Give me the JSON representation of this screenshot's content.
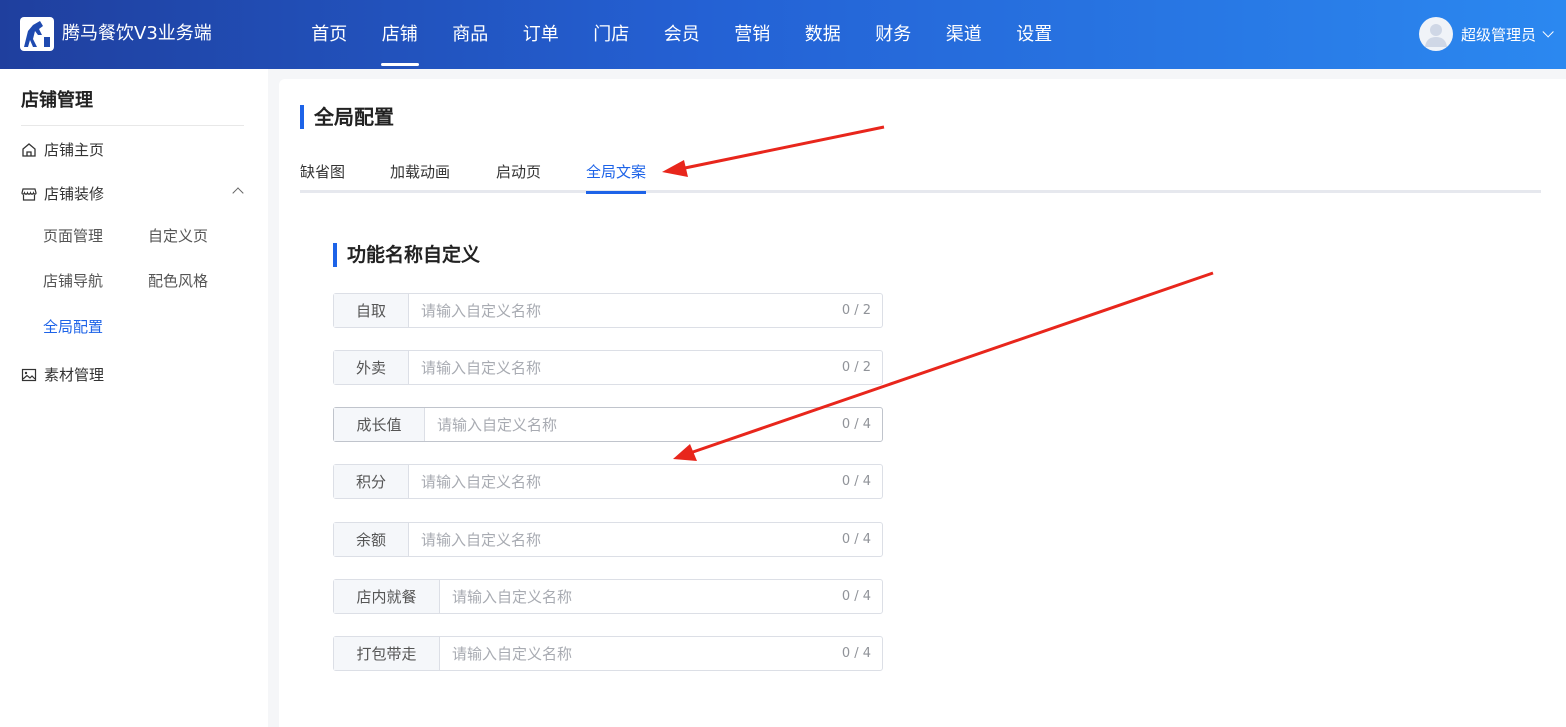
{
  "header": {
    "brand": "腾马餐饮V3业务端",
    "nav": [
      "首页",
      "店铺",
      "商品",
      "订单",
      "门店",
      "会员",
      "营销",
      "数据",
      "财务",
      "渠道",
      "设置"
    ],
    "active_nav": 1,
    "user_name": "超级管理员"
  },
  "sidebar": {
    "title": "店铺管理",
    "items": {
      "home": "店铺主页",
      "decoration": "店铺装修",
      "material": "素材管理"
    },
    "sub": {
      "page_manage": "页面管理",
      "custom_page": "自定义页",
      "shop_nav": "店铺导航",
      "color_style": "配色风格",
      "global_config": "全局配置"
    }
  },
  "main": {
    "title": "全局配置",
    "tabs": [
      "缺省图",
      "加载动画",
      "启动页",
      "全局文案"
    ],
    "active_tab": 3,
    "section_title": "功能名称自定义",
    "fields": [
      {
        "label": "自取",
        "placeholder": "请输入自定义名称",
        "count": "0 / 2"
      },
      {
        "label": "外卖",
        "placeholder": "请输入自定义名称",
        "count": "0 / 2"
      },
      {
        "label": "成长值",
        "placeholder": "请输入自定义名称",
        "count": "0 / 4"
      },
      {
        "label": "积分",
        "placeholder": "请输入自定义名称",
        "count": "0 / 4"
      },
      {
        "label": "余额",
        "placeholder": "请输入自定义名称",
        "count": "0 / 4"
      },
      {
        "label": "店内就餐",
        "placeholder": "请输入自定义名称",
        "count": "0 / 4"
      },
      {
        "label": "打包带走",
        "placeholder": "请输入自定义名称",
        "count": "0 / 4"
      }
    ]
  },
  "colors": {
    "accent": "#1d63e8",
    "header_start": "#1f3f9e",
    "header_end": "#2b88f0",
    "annotation": "#e8261c"
  }
}
